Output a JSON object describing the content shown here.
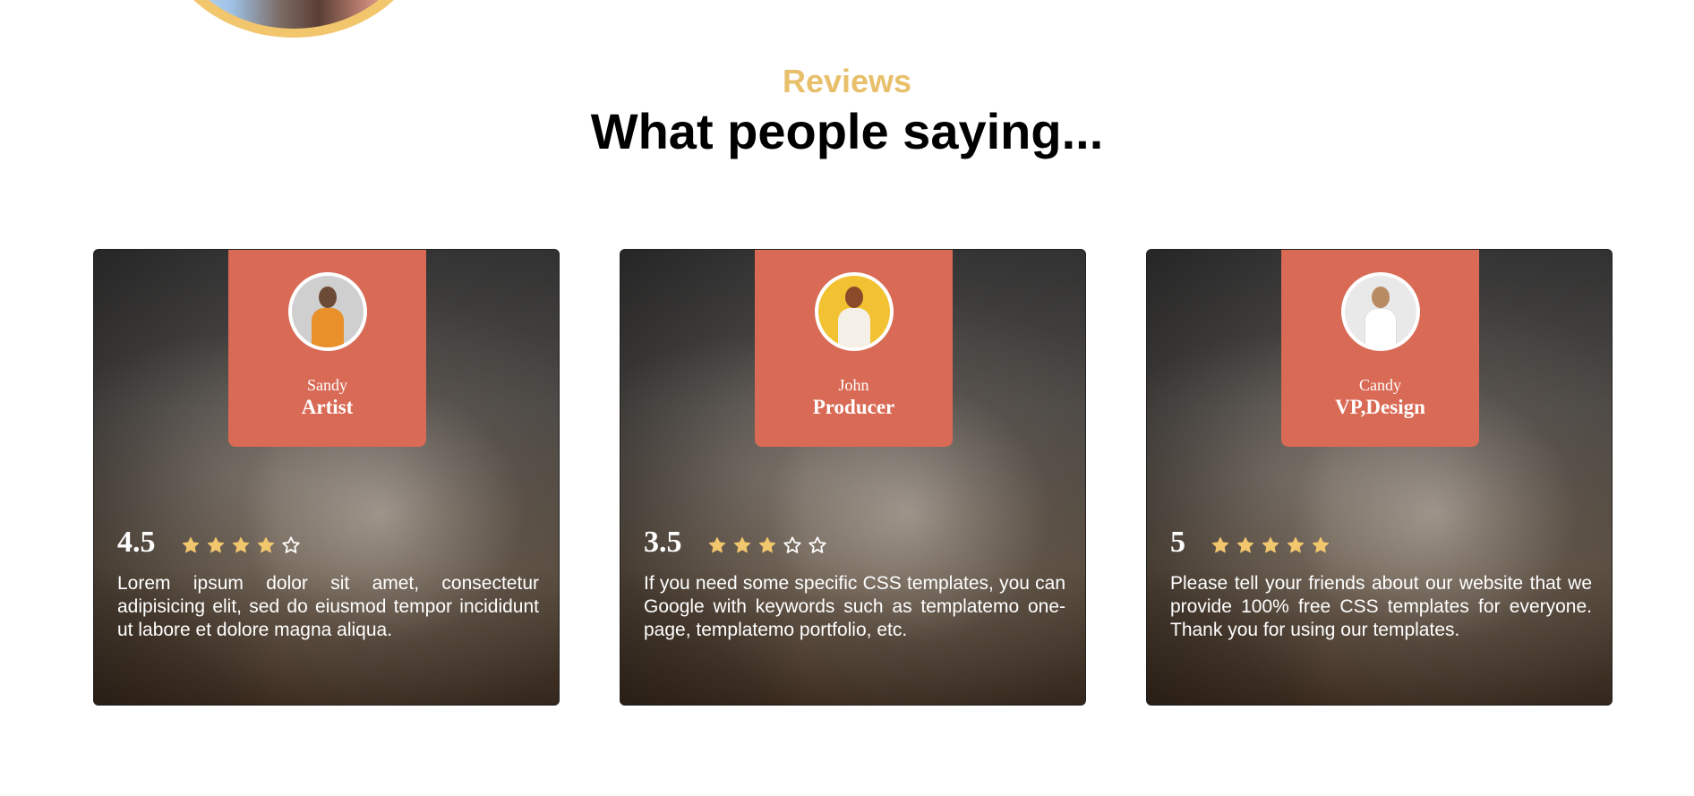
{
  "section": {
    "kicker": "Reviews",
    "title": "What people saying..."
  },
  "colors": {
    "accent": "#e8bf6a",
    "panel": "#d96a55",
    "star_filled": "#f2c66d"
  },
  "reviews": [
    {
      "name": "Sandy",
      "role": "Artist",
      "rating_label": "4.5",
      "stars": [
        "star-filled-icon",
        "star-filled-icon",
        "star-filled-icon",
        "star-filled-icon",
        "star-outline-icon"
      ],
      "text": "Lorem ipsum dolor sit amet, consectetur adipisicing elit, sed do eiusmod tempor incididunt ut labore et dolore magna aliqua."
    },
    {
      "name": "John",
      "role": "Producer",
      "rating_label": "3.5",
      "stars": [
        "star-filled-icon",
        "star-filled-icon",
        "star-filled-icon",
        "star-outline-icon",
        "star-outline-icon"
      ],
      "text": "If you need some specific CSS templates, you can Google with keywords such as templatemo one-page, templatemo portfolio, etc."
    },
    {
      "name": "Candy",
      "role": "VP,Design",
      "rating_label": "5",
      "stars": [
        "star-filled-icon",
        "star-filled-icon",
        "star-filled-icon",
        "star-filled-icon",
        "star-filled-icon"
      ],
      "text": "Please tell your friends about our website that we provide 100% free CSS templates for everyone. Thank you for using our templates."
    }
  ]
}
